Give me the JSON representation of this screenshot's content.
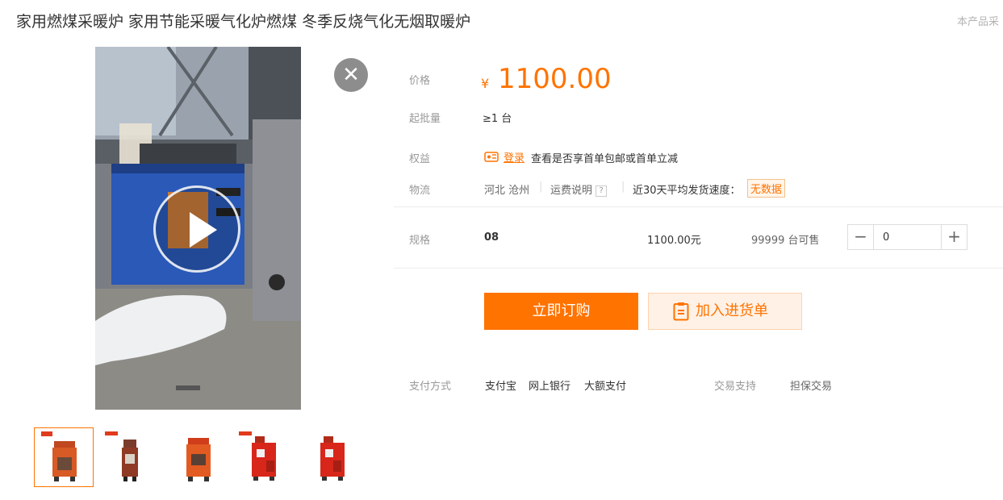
{
  "product": {
    "title": "家用燃煤采暖炉 家用节能采暖气化炉燃煤 冬季反烧气化无烟取暖炉",
    "corner_note": "本产品采"
  },
  "price": {
    "label": "价格",
    "currency": "¥",
    "value": "1100.00"
  },
  "moq": {
    "label": "起批量",
    "value": "≥1 台"
  },
  "benefits": {
    "label": "权益",
    "login_link": "登录",
    "text": "查看是否享首单包邮或首单立减"
  },
  "logistics": {
    "label": "物流",
    "origin": "河北 沧州",
    "shipping_label": "运费说明",
    "speed_label": "近30天平均发货速度：",
    "speed_value": "无数据"
  },
  "spec": {
    "label": "规格",
    "name": "08",
    "price": "1100.00元",
    "stock": "99999 台可售",
    "quantity": "0",
    "minus": "−",
    "plus": "+"
  },
  "actions": {
    "buy_now": "立即订购",
    "add_to_cart": "加入进货单"
  },
  "payment": {
    "label": "支付方式",
    "methods": [
      "支付宝",
      "网上银行",
      "大额支付"
    ],
    "support_label": "交易支持",
    "support_value": "担保交易"
  },
  "media": {
    "close": "✕",
    "thumbnail_count": 5,
    "active_thumbnail": 1
  },
  "colors": {
    "accent": "#ff7300",
    "label_gray": "#999999",
    "nodata_bg": "#fff6ec"
  }
}
